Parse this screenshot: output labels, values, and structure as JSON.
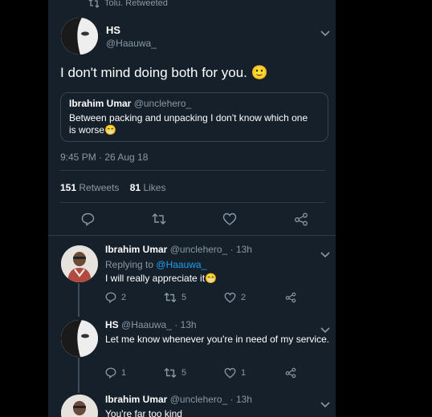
{
  "retweet_header": {
    "text": "Tolu. Retweeted"
  },
  "main_tweet": {
    "name": "HS",
    "handle": "@Haauwa_",
    "text": "I don't mind doing both for you. 🙂",
    "quoted": {
      "name": "Ibrahim Umar",
      "handle": "@unclehero_",
      "text": "Between packing and unpacking I don't know which one is worse😁"
    },
    "timestamp": "9:45 PM · 26 Aug 18",
    "stats": {
      "retweets_count": "151",
      "retweets_label": "Retweets",
      "likes_count": "81",
      "likes_label": "Likes"
    }
  },
  "replies": [
    {
      "name": "Ibrahim Umar",
      "handle": "@unclehero_",
      "time": "· 13h",
      "replying_label": "Replying to",
      "replying_to": "@Haauwa_",
      "text": "I will really appreciate it😁",
      "counts": {
        "reply": "2",
        "retweet": "5",
        "like": "2"
      }
    },
    {
      "name": "HS",
      "handle": "@Haauwa_",
      "time": "· 13h",
      "text": "Let me know whenever you're in need of my service.",
      "counts": {
        "reply": "1",
        "retweet": "5",
        "like": "1"
      }
    },
    {
      "name": "Ibrahim Umar",
      "handle": "@unclehero_",
      "time": "· 13h",
      "text": "You're far too kind"
    }
  ],
  "colors": {
    "background": "#15202b",
    "accent": "#1da1f2",
    "muted": "#8899a6",
    "divider": "#2f3b47"
  },
  "icons": [
    "retweet-icon",
    "chevron-down-icon",
    "reply-icon",
    "like-icon",
    "share-icon",
    "avatar-icon"
  ]
}
